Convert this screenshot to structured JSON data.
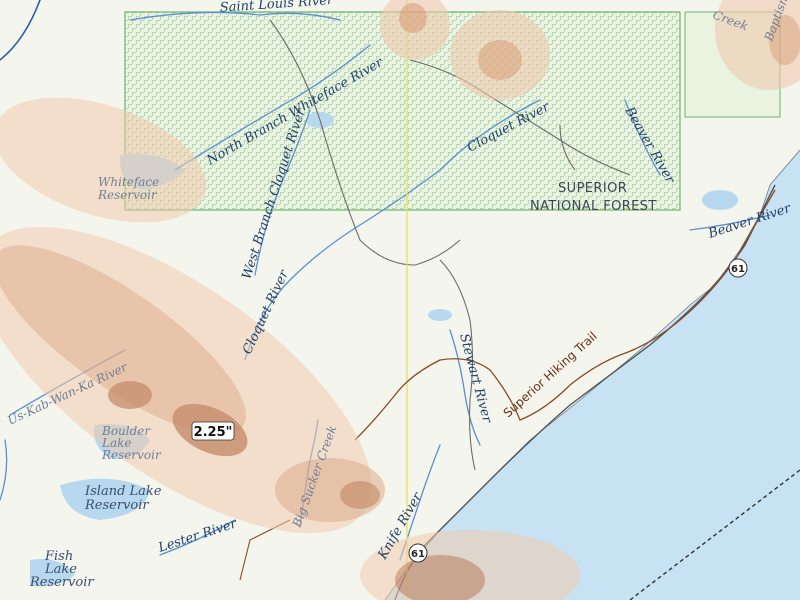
{
  "colors": {
    "land": "#f4f6ee",
    "lake_superior": "#c7e2f3",
    "lake": "#b7d8ef",
    "river": "#5a8fd0",
    "forest_boundary": "#6db36a",
    "road": "#6c6c6c",
    "trail": "#8a4a2a",
    "county_line": "#e6e25a",
    "precip_light": "#f0c9ae",
    "precip_mid": "#dba37f",
    "precip_dark": "#b9744e"
  },
  "labels": {
    "saint_louis_river": "Saint Louis River",
    "north_branch_whiteface": "North Branch Whiteface River",
    "whiteface_reservoir": [
      "Whiteface",
      "Reservoir"
    ],
    "west_branch_cloquet": "West Branch Cloquet River",
    "cloquet_river_north": "Cloquet River",
    "cloquet_river_south": "Cloquet River",
    "beaver_river_north": "Beaver River",
    "beaver_river_east": "Beaver River",
    "superior_national_forest": [
      "SUPERIOR",
      "NATIONAL FOREST"
    ],
    "stewart_river": "Stewart River",
    "superior_hiking_trail": "Superior Hiking Trail",
    "us_kab_wan_ka_river": "Us-Kab-Wan-Ka River",
    "boulder_lake_reservoir": [
      "Boulder",
      "Lake",
      "Reservoir"
    ],
    "island_lake_reservoir": [
      "Island Lake",
      "Reservoir"
    ],
    "lester_river": "Lester River",
    "fish_lake_reservoir": [
      "Fish",
      "Lake",
      "Reservoir"
    ],
    "sucker_creek": "Big Sucker Creek",
    "knife_river": "Knife River",
    "creek_top_right": "Creek",
    "baptism_top_right": "Baptism"
  },
  "highway_shields": [
    "61",
    "61"
  ],
  "precip_callout": "2.25\""
}
